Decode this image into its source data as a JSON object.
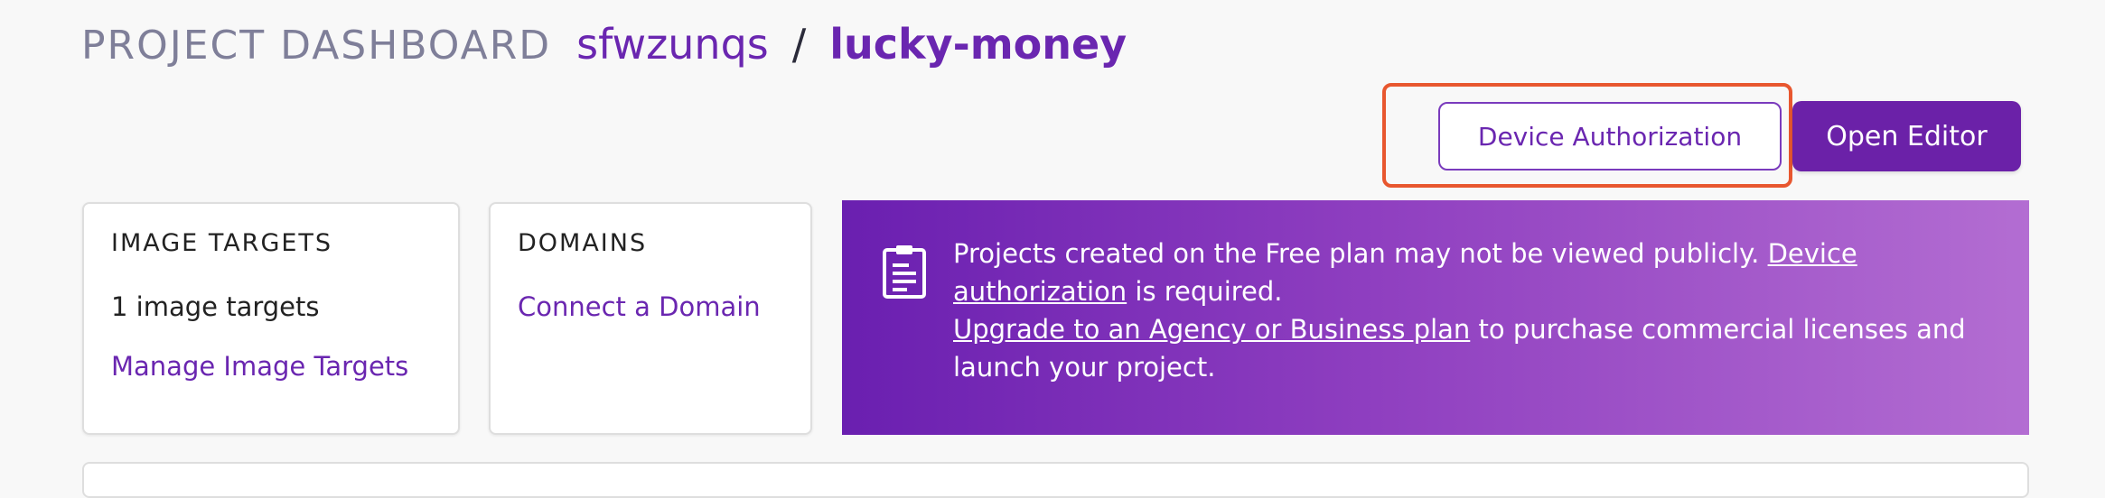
{
  "header": {
    "dashboard_label": "PROJECT DASHBOARD",
    "account": "sfwzunqs",
    "separator": "/",
    "project": "lucky-money"
  },
  "toolbar": {
    "device_authorization_label": "Device Authorization",
    "open_editor_label": "Open Editor"
  },
  "cards": {
    "image_targets": {
      "title": "IMAGE TARGETS",
      "count_text": "1 image targets",
      "link": "Manage Image Targets"
    },
    "domains": {
      "title": "DOMAINS",
      "link": "Connect a Domain"
    }
  },
  "banner": {
    "icon": "document-icon",
    "text_1": "Projects created on the Free plan may not be viewed publicly. ",
    "link_device_authorization": "Device authorization",
    "text_2": " is required.",
    "link_upgrade": "Upgrade to an Agency or Business plan",
    "text_3": " to purchase commercial licenses and launch your project."
  },
  "colors": {
    "brand_purple": "#6b21a8",
    "highlight_orange": "#e8572f",
    "muted_title": "#7f7f99"
  }
}
